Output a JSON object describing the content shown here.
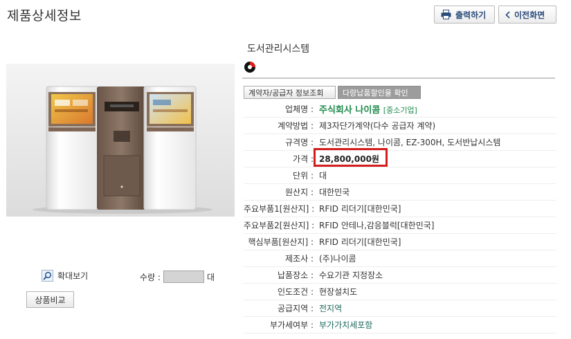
{
  "header": {
    "title": "제품상세정보",
    "print_label": "출력하기",
    "prev_label": "이전화면"
  },
  "left": {
    "zoom_label": "확대보기",
    "qty_label": "수량 :",
    "qty_value": "",
    "qty_unit": "대",
    "compare_label": "상품비교"
  },
  "product": {
    "name": "도서관리시스템",
    "btn_contractor": "계약자/공급자 정보조회",
    "btn_bulk": "다량납품할인율 확인"
  },
  "info": {
    "company_label": "업체명 :",
    "company": "주식회사 나이콤",
    "company_badge": "[중소기업]",
    "method_label": "계약방법 :",
    "method": "제3자단가계약(다수 공급자 계약)",
    "spec_label": "규격명 :",
    "spec": "도서관리시스템, 나이콤, EZ-300H, 도서반납시스템",
    "price_label": "가격 :",
    "price": "28,800,000원",
    "unit_label": "단위 :",
    "unit": "대",
    "origin_label": "원산지 :",
    "origin": "대한민국",
    "part1_label": "주요부품1[원산지] :",
    "part1": "RFID 리더기[대한민국]",
    "part2_label": "주요부품2[원산지] :",
    "part2": "RFID 안테나,감응블럭[대한민국]",
    "core_label": "핵심부품[원산지] :",
    "core": "RFID 리더기[대한민국]",
    "maker_label": "제조사 :",
    "maker": "(주)나이콤",
    "place_label": "납품장소 :",
    "place": "수요기관 지정장소",
    "delivery_label": "인도조건 :",
    "delivery": "현장설치도",
    "region_label": "공급지역 :",
    "region": "전지역",
    "vat_label": "부가세여부 :",
    "vat": "부가가치세포함"
  },
  "colors": {
    "accent_green": "#1f8a4c",
    "highlight_red": "#d41c1c"
  },
  "icons": [
    "printer-icon",
    "chevron-left-icon",
    "magnifier-icon",
    "brand-logo"
  ]
}
